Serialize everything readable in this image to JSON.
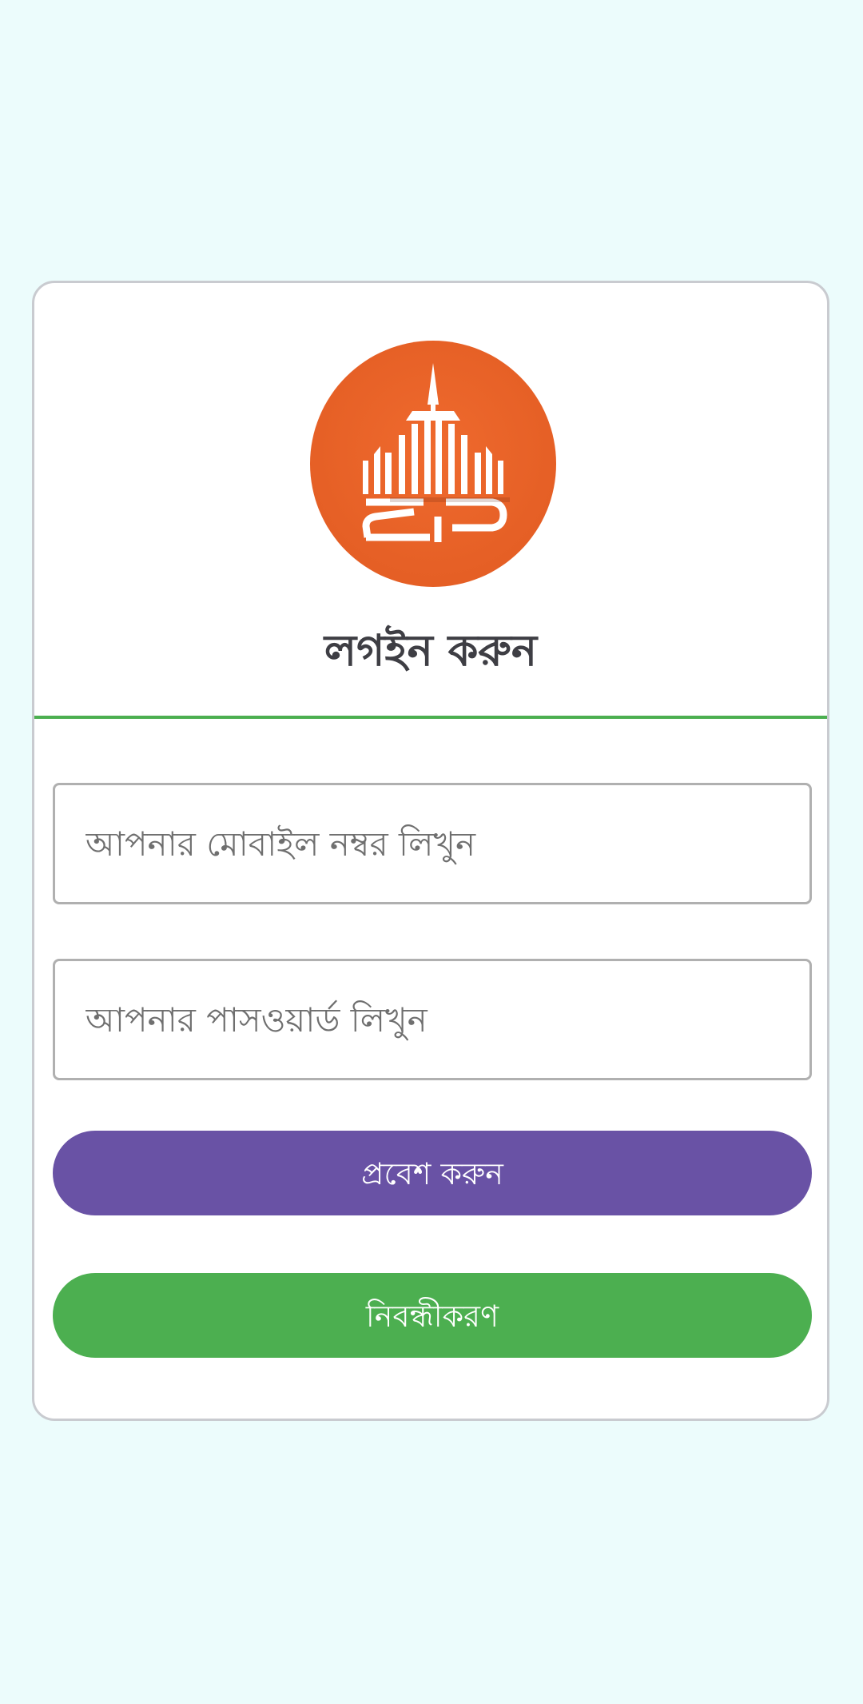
{
  "login": {
    "title": "লগইন করুন",
    "mobile_placeholder": "আপনার মোবাইল নম্বর লিখুন",
    "password_placeholder": "আপনার পাসওয়ার্ড লিখুন",
    "login_button": "প্রবেশ করুন",
    "register_button": "নিবন্ধীকরণ"
  },
  "colors": {
    "background": "#ecfcfc",
    "logo": "#e55f25",
    "login_button": "#6952a5",
    "register_button": "#4caf50",
    "divider": "#4caf50"
  },
  "icons": {
    "logo": "building-logo-icon"
  }
}
